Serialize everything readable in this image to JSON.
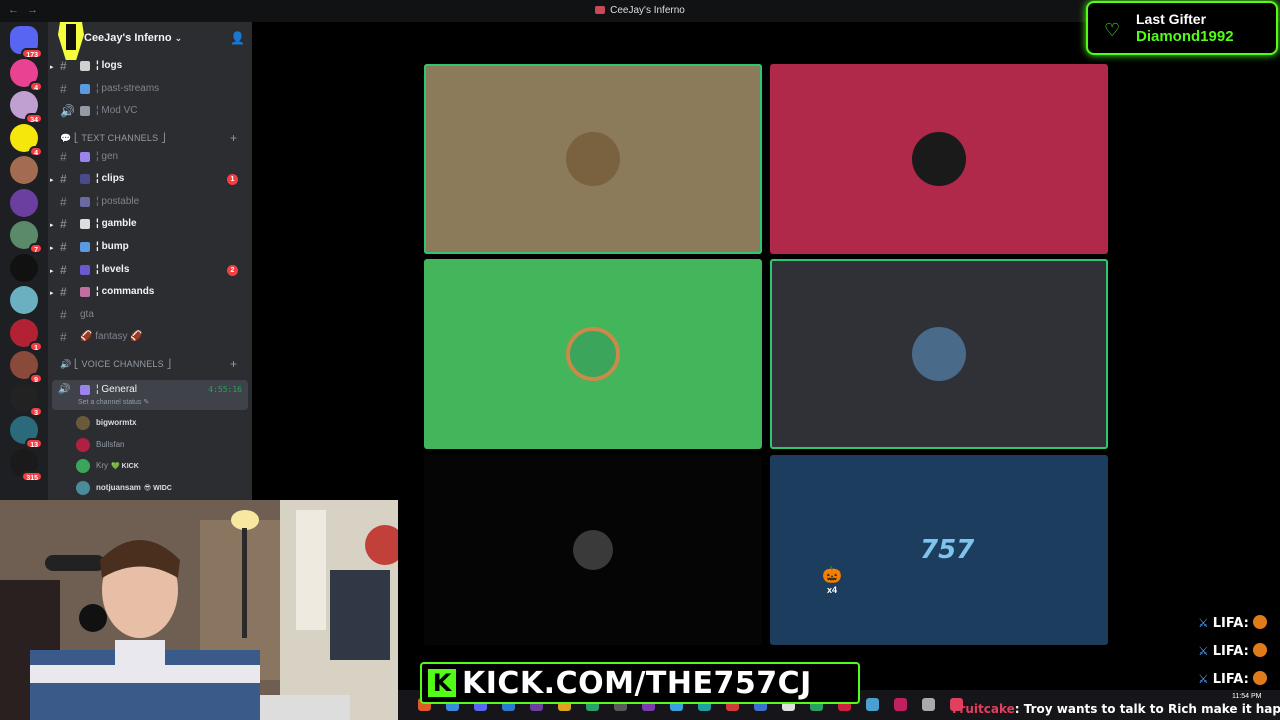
{
  "window": {
    "title": "CeeJay's Inferno"
  },
  "server": {
    "name": "CeeJay's Inferno"
  },
  "rail": [
    {
      "color": "#5865f2",
      "badge": "173",
      "icon": "discord-home-icon"
    },
    {
      "color": "#e84393",
      "badge": "4"
    },
    {
      "color": "#c0a0d0",
      "badge": "34"
    },
    {
      "color": "#f5e60c",
      "badge": "4"
    },
    {
      "color": "#a36b4f",
      "badge": ""
    },
    {
      "color": "#6a3fa0",
      "badge": ""
    },
    {
      "color": "#5a8a6a",
      "badge": "7"
    },
    {
      "color": "#111111",
      "badge": ""
    },
    {
      "color": "#6ab0c0",
      "badge": ""
    },
    {
      "color": "#b22234",
      "badge": "1"
    },
    {
      "color": "#8a4a3a",
      "badge": "9"
    },
    {
      "color": "#222222",
      "badge": "3"
    },
    {
      "color": "#2a6a7a",
      "badge": "13"
    },
    {
      "color": "#1a1a1a",
      "badge": "315"
    }
  ],
  "channels_top": [
    {
      "label": "¦ logs",
      "unread": true,
      "emoji_color": "#d0d0d0"
    },
    {
      "label": "¦ past-streams",
      "unread": false,
      "emoji_color": "#5a9ae0"
    },
    {
      "label": "¦ Mod VC",
      "unread": false,
      "emoji_color": "#949ba4",
      "voice": true
    }
  ],
  "text_category": "💬 ⎣ TEXT CHANNELS ⎦",
  "text_channels": [
    {
      "label": "¦ gen",
      "unread": false,
      "emoji_color": "#9b84ee",
      "mention": ""
    },
    {
      "label": "¦ clips",
      "unread": true,
      "emoji_color": "#4a4a8a",
      "mention": "1"
    },
    {
      "label": "¦ postable",
      "unread": false,
      "emoji_color": "#6a6aa0",
      "mention": ""
    },
    {
      "label": "¦ gamble",
      "unread": true,
      "emoji_color": "#dddddd",
      "mention": ""
    },
    {
      "label": "¦ bump",
      "unread": true,
      "emoji_color": "#5a9ae0",
      "mention": ""
    },
    {
      "label": "¦ levels",
      "unread": true,
      "emoji_color": "#6a5ad0",
      "mention": "2"
    },
    {
      "label": "¦ commands",
      "unread": true,
      "emoji_color": "#c070a0",
      "mention": ""
    },
    {
      "label": "gta",
      "unread": false,
      "emoji_color": "",
      "mention": ""
    },
    {
      "label": "🏈 fantasy 🏈",
      "unread": false,
      "emoji_color": "",
      "mention": ""
    }
  ],
  "voice_category": "🔊 ⎣ VOICE CHANNELS ⎦",
  "voice_channel": {
    "label": "¦ General",
    "timer": "4:55:16",
    "status": "Set a channel status ✎"
  },
  "voice_users": [
    {
      "name": "bigwormtx",
      "muted": false,
      "color": "#6a5a3a",
      "tag": ""
    },
    {
      "name": "Bullsfan",
      "muted": true,
      "color": "#b02040",
      "tag": ""
    },
    {
      "name": "Kry",
      "muted": true,
      "color": "#3ba55c",
      "tag": "💚 KICK"
    },
    {
      "name": "notjuansam",
      "muted": false,
      "color": "#4a8a9a",
      "tag": "😎 WIDC"
    }
  ],
  "tiles": [
    {
      "bg": "#8c7b5a",
      "avatar_color": "#7a6240",
      "speaking": true,
      "icon": "cowboy-avatar"
    },
    {
      "bg": "#b0294a",
      "avatar_color": "#1a1a1a",
      "speaking": false,
      "icon": "bulls-avatar"
    },
    {
      "bg": "#43b55a",
      "avatar_color": "#5865f2",
      "speaking": false,
      "icon": "discord-avatar"
    },
    {
      "bg": "#2f3136",
      "avatar_color": "#4a6a8a",
      "speaking": true,
      "icon": "user-avatar"
    },
    {
      "bg": "#050505",
      "avatar_color": "#3a3a3a",
      "speaking": false,
      "icon": "default-avatar"
    },
    {
      "bg": "#1c3d5e",
      "avatar_color": "#3a8ab0",
      "speaking": false,
      "icon": "757-logo"
    }
  ],
  "tile_reaction": {
    "emoji": "🎃",
    "count": "x4"
  },
  "tile_logo_text": "757",
  "overlay": {
    "gifter_title": "Last Gifter",
    "gifter_name": "Diamond1992",
    "kick_url": "KICK.COM/THE757CJ",
    "chat_user": "LIFA:",
    "ticker_user": "Fruitcake",
    "ticker_msg": ": Troy wants to talk to Rich make it happen",
    "clock": "11:54 PM"
  },
  "colors": {
    "kick_green": "#53fc18",
    "discord_bg": "#2b2d31",
    "rail_bg": "#1e1f22"
  }
}
